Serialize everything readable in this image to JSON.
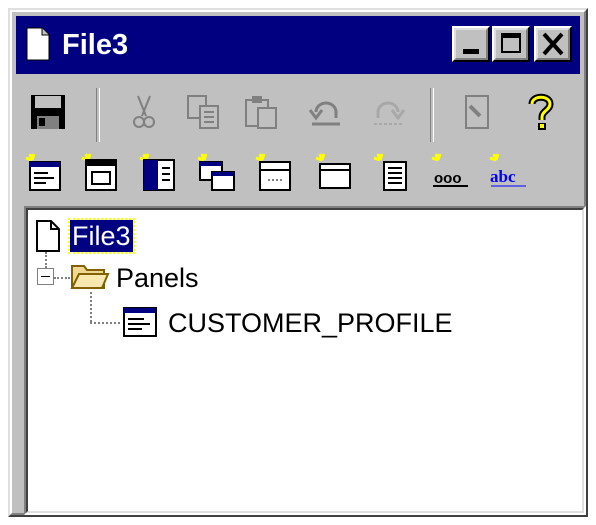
{
  "window": {
    "title": "File3",
    "controls": {
      "minimize": "minimize",
      "maximize": "maximize",
      "close": "close"
    }
  },
  "toolbar1": {
    "items": [
      {
        "name": "save-icon",
        "enabled": true
      },
      {
        "name": "cut-icon",
        "enabled": false
      },
      {
        "name": "copy-icon",
        "enabled": false
      },
      {
        "name": "paste-icon",
        "enabled": false
      },
      {
        "name": "undo-icon",
        "enabled": false
      },
      {
        "name": "redo-icon",
        "enabled": false
      },
      {
        "name": "properties-icon",
        "enabled": false
      },
      {
        "name": "help-icon",
        "enabled": true
      }
    ]
  },
  "toolbar2": {
    "items": [
      {
        "name": "new-panel-icon"
      },
      {
        "name": "new-window-icon"
      },
      {
        "name": "new-menu-icon"
      },
      {
        "name": "new-popup-window-icon"
      },
      {
        "name": "new-menu-bar-icon"
      },
      {
        "name": "new-record-icon"
      },
      {
        "name": "new-list-icon"
      },
      {
        "name": "new-format-icon"
      },
      {
        "name": "new-text-icon"
      }
    ],
    "format_icon_text": "ooo",
    "text_icon_text": "abc"
  },
  "tree": {
    "root": {
      "label": "File3",
      "selected": true
    },
    "folder": {
      "label": "Panels",
      "expanded": true
    },
    "child": {
      "label": "CUSTOMER_PROFILE"
    }
  },
  "colors": {
    "title_bar": "#000080",
    "face": "#c0c0c0",
    "selection": "#000080",
    "focus_outline": "#ffff00",
    "help_icon": "#ffff00",
    "folder": "#f0d890"
  }
}
